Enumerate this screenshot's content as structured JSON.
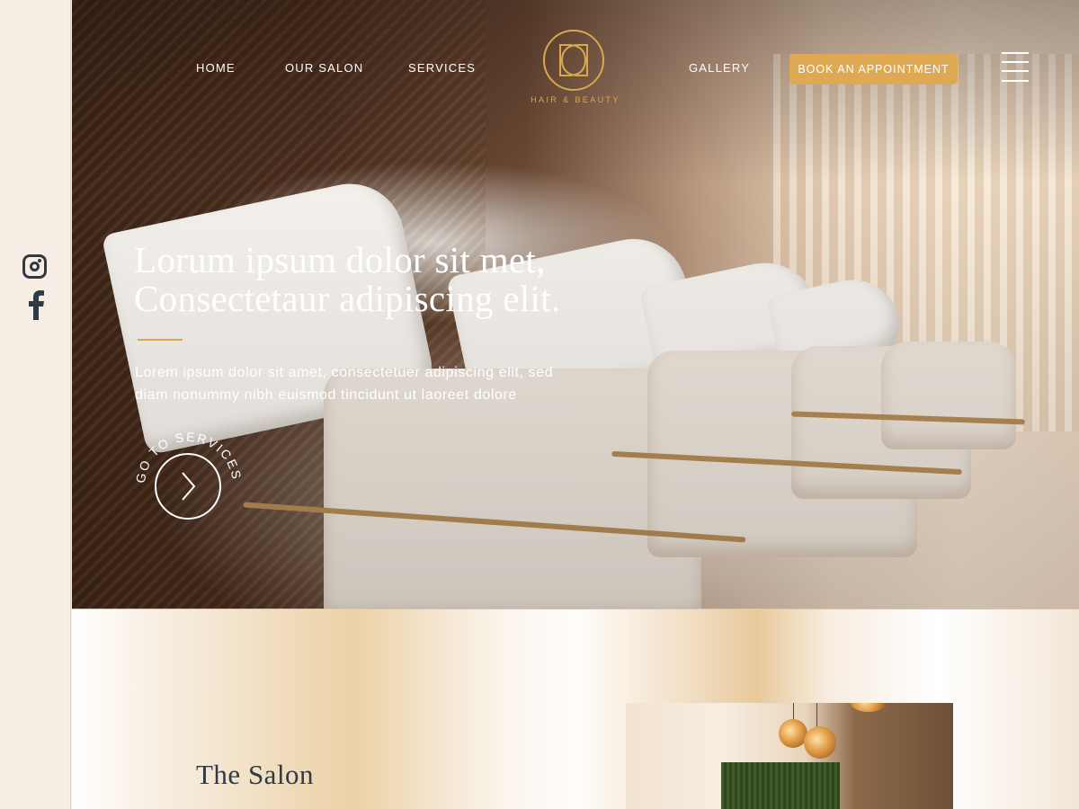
{
  "social": {
    "instagram": "instagram-icon",
    "facebook": "facebook-icon"
  },
  "nav": {
    "home": "HOME",
    "our_salon": "OUR SALON",
    "services": "SERVICES",
    "gallery": "GALLERY",
    "book": "BOOK AN APPOINTMENT",
    "menu_icon": "hamburger-menu-icon"
  },
  "logo": {
    "text": "HAIR & BEAUTY",
    "color": "#d8a84e"
  },
  "hero": {
    "title_line1": "Lorum ipsum dolor sit met,",
    "title_line2": "Consectetaur adipiscing elit.",
    "sub_line1": "Lorem ipsum dolor sit amet, consectetuer adipiscing elit, sed",
    "sub_line2": "diam nonummy nibh euismod tincidunt ut laoreet dolore",
    "cta_circle_text": "GO TO SERVICES"
  },
  "salon": {
    "title": "The Salon"
  },
  "colors": {
    "accent": "#dfa852",
    "text_dark": "#2f3a44",
    "rail_bg": "#f6ede4"
  }
}
